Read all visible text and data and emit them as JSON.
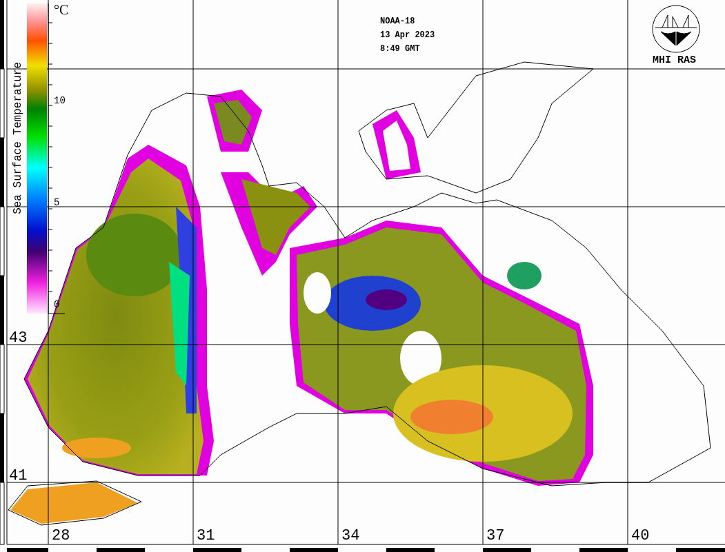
{
  "header": {
    "satellite": "NOAA-18",
    "date": "13 Apr 2023",
    "time": "8:49 GMT"
  },
  "logo": {
    "text": "MHI RAS"
  },
  "legend": {
    "title": "Sea Surface Temperature",
    "unit": "°C",
    "ticks": [
      {
        "label": "10"
      },
      {
        "label": "5"
      },
      {
        "label": "0"
      }
    ]
  },
  "latitude_labels": [
    "43",
    "41"
  ],
  "longitude_labels": [
    "28",
    "31",
    "34",
    "37",
    "40"
  ]
}
